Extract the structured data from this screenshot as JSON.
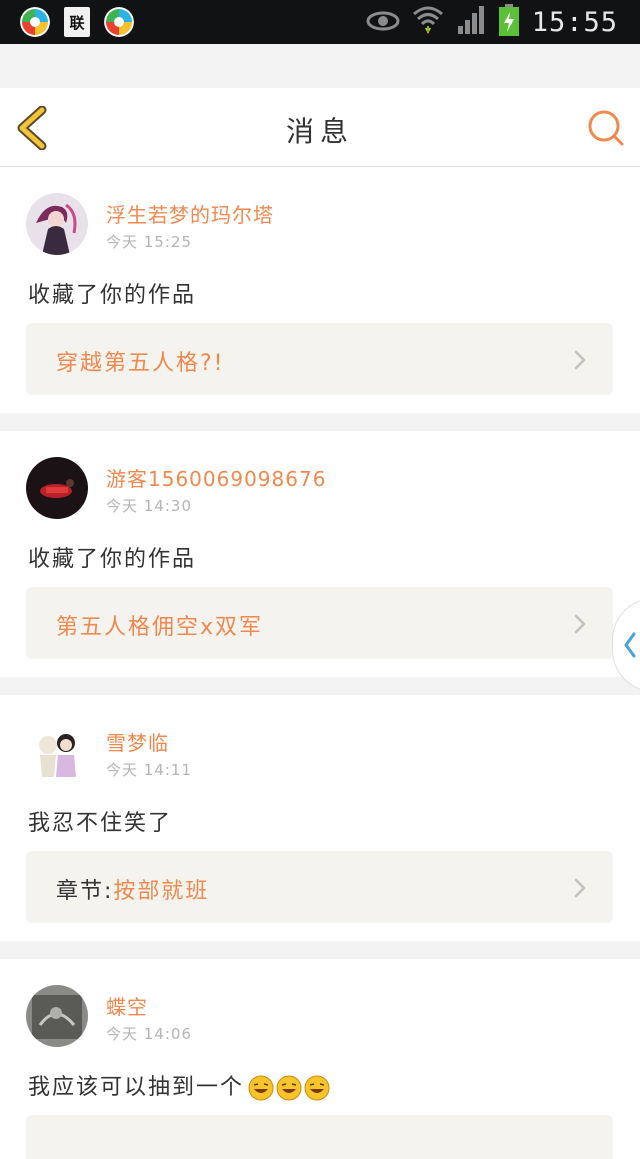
{
  "status_bar": {
    "time": "15:55",
    "sim_label": "联"
  },
  "header": {
    "title": "消息"
  },
  "messages": [
    {
      "username": "浮生若梦的玛尔塔",
      "time": "今天 15:25",
      "action": "收藏了你的作品",
      "link_prefix": "",
      "link": "穿越第五人格?!"
    },
    {
      "username": "游客1560069098676",
      "time": "今天 14:30",
      "action": "收藏了你的作品",
      "link_prefix": "",
      "link": "第五人格佣空x双军"
    },
    {
      "username": "雪梦临",
      "time": "今天 14:11",
      "action": "我忍不住笑了",
      "link_prefix": "章节:",
      "link": "按部就班"
    },
    {
      "username": "蝶空",
      "time": "今天 14:06",
      "action": "我应该可以抽到一个",
      "emoji_count": 3
    }
  ],
  "colors": {
    "accent": "#f0894f",
    "back_arrow": "#f2c43a",
    "link_bg": "#f4f3ee"
  }
}
